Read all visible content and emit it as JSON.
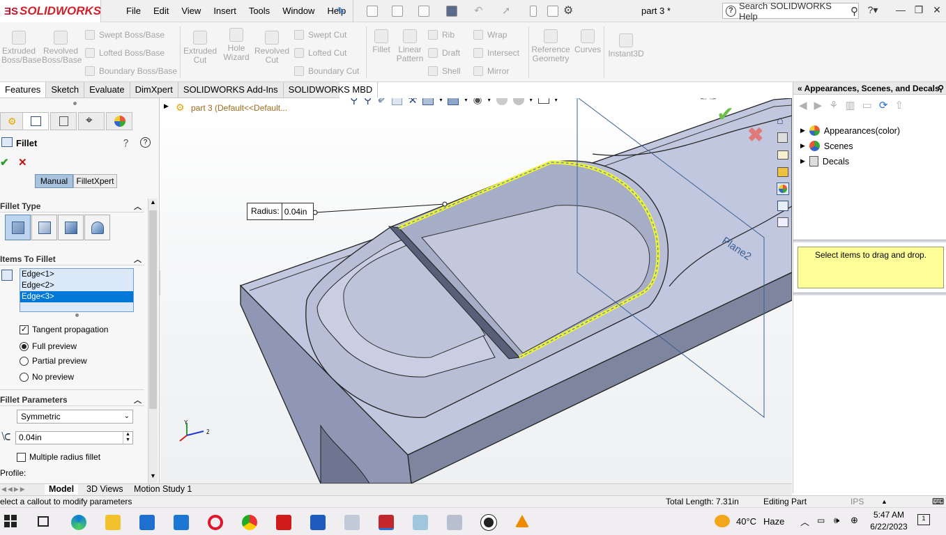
{
  "app": {
    "brand": "SOLIDWORKS",
    "document_title": "part 3 *",
    "search_placeholder": "Search SOLIDWORKS Help",
    "menu": [
      "File",
      "Edit",
      "View",
      "Insert",
      "Tools",
      "Window",
      "Help"
    ]
  },
  "commands": {
    "large": [
      {
        "label": "Extruded\nBoss/Base",
        "icon": "extruded-boss-icon"
      },
      {
        "label": "Revolved\nBoss/Base",
        "icon": "revolved-boss-icon"
      },
      {
        "label": "Extruded\nCut",
        "icon": "extruded-cut-icon"
      },
      {
        "label": "Hole\nWizard",
        "icon": "hole-wizard-icon"
      },
      {
        "label": "Revolved\nCut",
        "icon": "revolved-cut-icon"
      },
      {
        "label": "Fillet",
        "icon": "fillet-icon"
      },
      {
        "label": "Linear\nPattern",
        "icon": "linear-pattern-icon"
      },
      {
        "label": "Reference\nGeometry",
        "icon": "reference-geometry-icon"
      },
      {
        "label": "Curves",
        "icon": "curves-icon"
      },
      {
        "label": "Instant3D",
        "icon": "instant3d-icon"
      }
    ],
    "small": [
      "Swept Boss/Base",
      "Lofted Boss/Base",
      "Boundary Boss/Base",
      "Swept Cut",
      "Lofted Cut",
      "Boundary Cut",
      "Rib",
      "Draft",
      "Shell",
      "Wrap",
      "Intersect",
      "Mirror"
    ]
  },
  "tabs": [
    "Features",
    "Sketch",
    "Evaluate",
    "DimXpert",
    "SOLIDWORKS Add-Ins",
    "SOLIDWORKS MBD"
  ],
  "property_manager": {
    "title": "Fillet",
    "mode_tabs": [
      "Manual",
      "FilletXpert"
    ],
    "fillet_type_header": "Fillet Type",
    "items_header": "Items To Fillet",
    "edges": [
      "Edge<1>",
      "Edge<2>",
      "Edge<3>"
    ],
    "tangent_propagation": "Tangent propagation",
    "preview_options": [
      "Full preview",
      "Partial preview",
      "No preview"
    ],
    "selected_preview": "Full preview",
    "params_header": "Fillet Parameters",
    "profile_type": "Symmetric",
    "radius_value": "0.04in",
    "multiple_radius": "Multiple radius fillet",
    "profile_label": "Profile:"
  },
  "viewport": {
    "tree_label": "part 3  (Default<<Default...",
    "callout_label": "Radius:",
    "callout_value": "0.04in",
    "plane_label": "Plane2"
  },
  "task_pane": {
    "title": "Appearances, Scenes, and Decals",
    "items": [
      "Appearances(color)",
      "Scenes",
      "Decals"
    ],
    "hint": "Select items to drag and drop."
  },
  "bottom_tabs": [
    "Model",
    "3D Views",
    "Motion Study 1"
  ],
  "status": {
    "message": "elect a callout to modify parameters",
    "total_length": "Total Length: 7.31in",
    "mode": "Editing Part",
    "units": "IPS"
  },
  "taskbar": {
    "weather_temp": "40°C",
    "weather_text": "Haze",
    "time": "5:47 AM",
    "date": "6/22/2023"
  },
  "colors": {
    "accent_blue": "#1e78d2",
    "brand_red": "#d0202a",
    "selection_highlight": "#0078d7",
    "fillet_preview": "#f2f230",
    "model_body": "#b8bfd6"
  }
}
